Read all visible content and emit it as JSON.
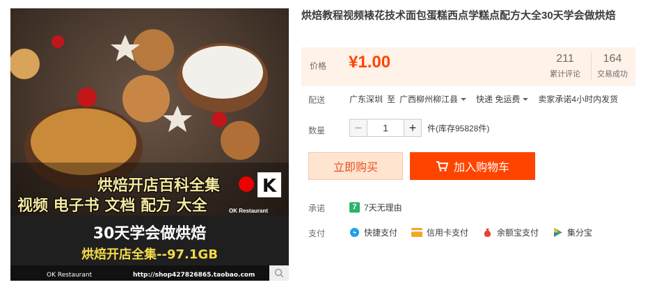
{
  "image_overlay": {
    "promo_line1": "烘焙开店百科全集",
    "promo_line2": "视频 电子书 文档 配方 大全",
    "promo_line3": "30天学会做烘焙",
    "promo_line4": "烘焙开店全集--97.1GB",
    "brand": "OK Restaurant",
    "footer_left": "OK Restaurant",
    "footer_url": "http://shop427826865.taobao.com"
  },
  "product": {
    "title": "烘焙教程视频裱花技术面包蛋糕西点学糕点配方大全30天学会做烘焙"
  },
  "price": {
    "label": "价格",
    "value": "¥1.00",
    "reviews_count": "211",
    "reviews_label": "累计评论",
    "deals_count": "164",
    "deals_label": "交易成功"
  },
  "delivery": {
    "label": "配送",
    "from": "广东深圳",
    "to_word": "至",
    "to": "广西柳州柳江县",
    "shipping": "快递 免运费",
    "promise": "卖家承诺4小时内发货"
  },
  "quantity": {
    "label": "数量",
    "minus": "−",
    "value": "1",
    "plus": "+",
    "stock": "件(库存95828件)"
  },
  "actions": {
    "buy_now": "立即购买",
    "add_cart": "加入购物车"
  },
  "promise": {
    "label": "承诺",
    "item": "7天无理由",
    "icon_text": "7"
  },
  "payment": {
    "label": "支付",
    "items": [
      "快捷支付",
      "信用卡支付",
      "余额宝支付",
      "集分宝"
    ]
  },
  "colors": {
    "accent": "#ff4400",
    "price_bg": "#fff2e8"
  }
}
